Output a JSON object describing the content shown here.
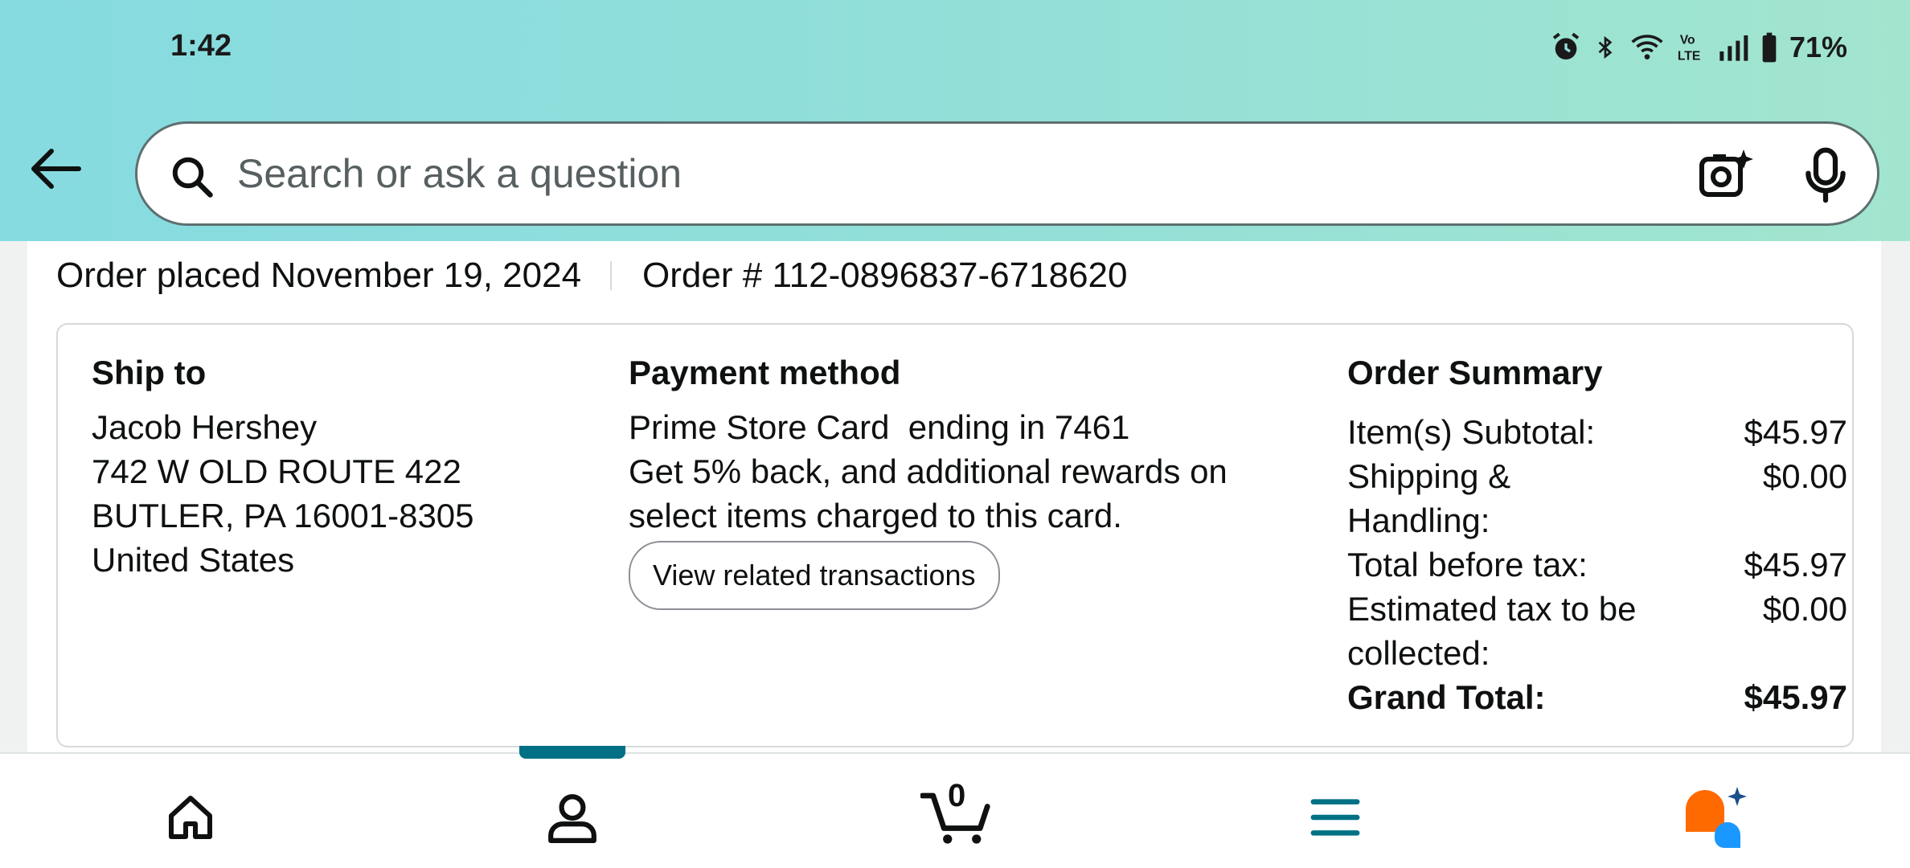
{
  "status_bar": {
    "time": "1:42",
    "battery": "71%",
    "icons": [
      "alarm-icon",
      "bluetooth-icon",
      "wifi-icon",
      "volte-icon",
      "signal-icon",
      "battery-icon"
    ]
  },
  "search": {
    "placeholder": "Search or ask a question"
  },
  "order": {
    "placed_label": "Order placed November 19, 2024",
    "number_label": "Order # 112-0896837-6718620"
  },
  "ship_to": {
    "title": "Ship to",
    "name": "Jacob Hershey",
    "street": "742 W OLD ROUTE 422",
    "city": "BUTLER, PA 16001-8305",
    "country": "United States"
  },
  "payment": {
    "title": "Payment method",
    "card": "Prime Store Card  ending in 7461",
    "promo_line1": "Get 5% back, and additional rewards on",
    "promo_line2": "select items charged to this card.",
    "button": "View related transactions"
  },
  "summary": {
    "title": "Order Summary",
    "rows": [
      {
        "label": "Item(s) Subtotal:",
        "value": "$45.97"
      },
      {
        "label": "Shipping & Handling:",
        "value": "$0.00"
      },
      {
        "label": "Total before tax:",
        "value": "$45.97"
      },
      {
        "label": "Estimated tax to be collected:",
        "value": "$0.00"
      }
    ],
    "grand_total_label": "Grand Total:",
    "grand_total_value": "$45.97"
  },
  "bottom_nav": {
    "items": [
      "home-icon",
      "account-icon",
      "cart-icon",
      "menu-icon",
      "rufus-icon"
    ],
    "cart_count": "0",
    "active": "account-icon"
  },
  "colors": {
    "accent": "#007185",
    "header_start": "#86dbe0",
    "header_end": "#a2e5cf",
    "rufus_orange": "#ff6a00",
    "rufus_blue": "#1a98ff"
  }
}
